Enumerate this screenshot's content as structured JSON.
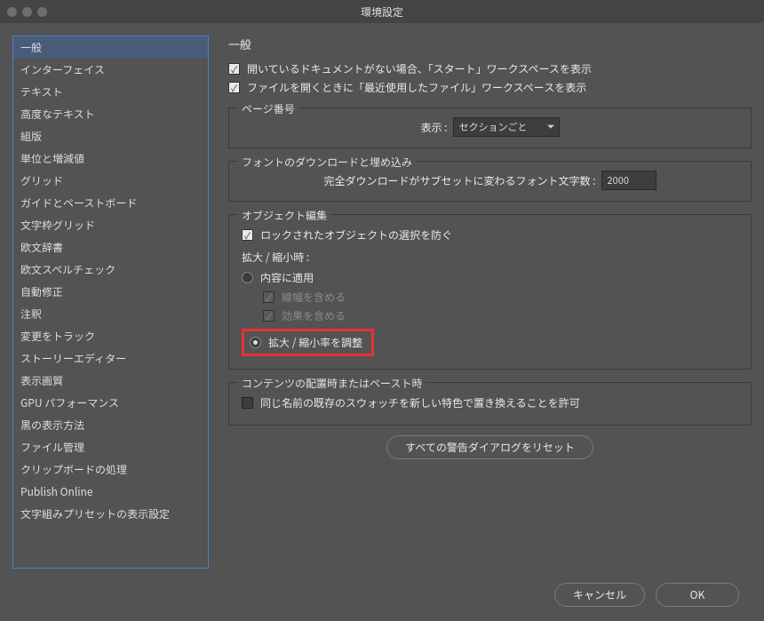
{
  "window": {
    "title": "環境設定"
  },
  "sidebar": {
    "items": [
      {
        "label": "一般",
        "selected": true
      },
      {
        "label": "インターフェイス"
      },
      {
        "label": "テキスト"
      },
      {
        "label": "高度なテキスト"
      },
      {
        "label": "組版"
      },
      {
        "label": "単位と増減値"
      },
      {
        "label": "グリッド"
      },
      {
        "label": "ガイドとペーストボード"
      },
      {
        "label": "文字枠グリッド"
      },
      {
        "label": "欧文辞書"
      },
      {
        "label": "欧文スペルチェック"
      },
      {
        "label": "自動修正"
      },
      {
        "label": "注釈"
      },
      {
        "label": "変更をトラック"
      },
      {
        "label": "ストーリーエディター"
      },
      {
        "label": "表示画質"
      },
      {
        "label": "GPU パフォーマンス"
      },
      {
        "label": "黒の表示方法"
      },
      {
        "label": "ファイル管理"
      },
      {
        "label": "クリップボードの処理"
      },
      {
        "label": "Publish Online"
      },
      {
        "label": "文字組みプリセットの表示設定"
      }
    ]
  },
  "main": {
    "heading": "一般",
    "check_start_ws": "開いているドキュメントがない場合、「スタート」ワークスペースを表示",
    "check_recent_ws": "ファイルを開くときに「最近使用したファイル」ワークスペースを表示",
    "page_number": {
      "group_label": "ページ番号",
      "show_label": "表示 :",
      "show_value": "セクションごと"
    },
    "font_embed": {
      "group_label": "フォントのダウンロードと埋め込み",
      "label": "完全ダウンロードがサブセットに変わるフォント文字数 :",
      "value": "2000"
    },
    "object_edit": {
      "group_label": "オブジェクト編集",
      "check_lock": "ロックされたオブジェクトの選択を防ぐ",
      "scale_heading": "拡大 / 縮小時 :",
      "radio_apply_content": "内容に適用",
      "check_include_stroke": "線幅を含める",
      "check_include_effects": "効果を含める",
      "radio_adjust_percent": "拡大 / 縮小率を調整"
    },
    "paste": {
      "group_label": "コンテンツの配置時またはペースト時",
      "check_replace_swatch": "同じ名前の既存のスウォッチを新しい特色で置き換えることを許可"
    },
    "reset_button": "すべての警告ダイアログをリセット"
  },
  "footer": {
    "cancel": "キャンセル",
    "ok": "OK"
  }
}
